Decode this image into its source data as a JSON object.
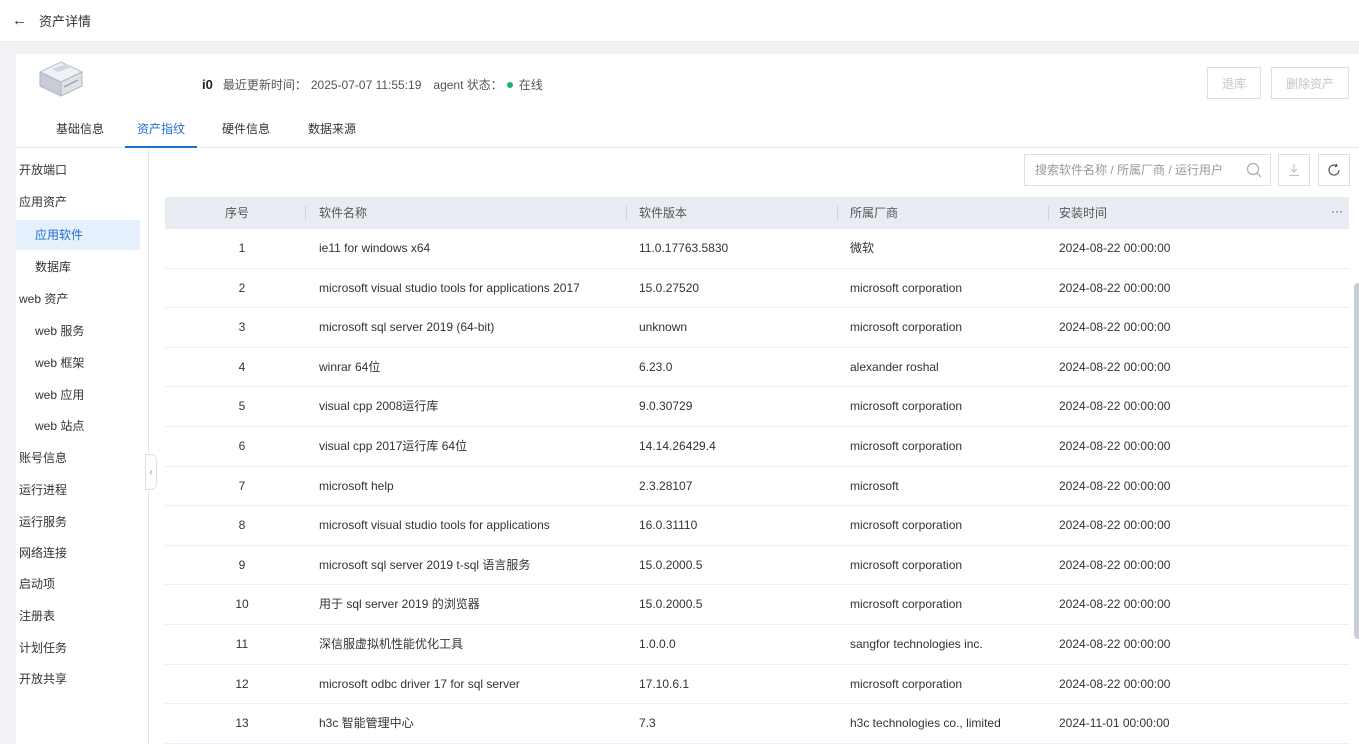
{
  "page": {
    "title": "资产详情"
  },
  "header": {
    "asset_name": "i0",
    "updated_label": "最近更新时间：",
    "updated_value": "2025-07-07 11:55:19",
    "agent_label": "agent 状态：",
    "agent_status": "在线",
    "status_color": "#19b36a"
  },
  "actions": {
    "retire": "退库",
    "delete": "删除资产"
  },
  "tabs": [
    {
      "label": "基础信息"
    },
    {
      "label": "资产指纹"
    },
    {
      "label": "硬件信息"
    },
    {
      "label": "数据来源"
    }
  ],
  "sidebar": [
    {
      "label": "开放端口"
    },
    {
      "label": "应用资产"
    },
    {
      "label": "应用软件"
    },
    {
      "label": "数据库"
    },
    {
      "label": "web 资产"
    },
    {
      "label": "web 服务"
    },
    {
      "label": "web 框架"
    },
    {
      "label": "web 应用"
    },
    {
      "label": "web 站点"
    },
    {
      "label": "账号信息"
    },
    {
      "label": "运行进程"
    },
    {
      "label": "运行服务"
    },
    {
      "label": "网络连接"
    },
    {
      "label": "启动项"
    },
    {
      "label": "注册表"
    },
    {
      "label": "计划任务"
    },
    {
      "label": "开放共享"
    }
  ],
  "search": {
    "placeholder": "搜索软件名称 / 所属厂商 / 运行用户"
  },
  "table": {
    "columns": [
      "序号",
      "软件名称",
      "软件版本",
      "所属厂商",
      "安装时间"
    ],
    "more": "···",
    "rows": [
      {
        "no": "1",
        "name": "ie11 for windows x64",
        "version": "11.0.17763.5830",
        "vendor": "微软",
        "time": "2024-08-22 00:00:00"
      },
      {
        "no": "2",
        "name": "microsoft visual studio tools for applications 2017",
        "version": "15.0.27520",
        "vendor": "microsoft corporation",
        "time": "2024-08-22 00:00:00"
      },
      {
        "no": "3",
        "name": "microsoft sql server 2019 (64-bit)",
        "version": "unknown",
        "vendor": "microsoft corporation",
        "time": "2024-08-22 00:00:00"
      },
      {
        "no": "4",
        "name": "winrar 64位",
        "version": "6.23.0",
        "vendor": "alexander roshal",
        "time": "2024-08-22 00:00:00"
      },
      {
        "no": "5",
        "name": "visual cpp 2008运行库",
        "version": "9.0.30729",
        "vendor": "microsoft corporation",
        "time": "2024-08-22 00:00:00"
      },
      {
        "no": "6",
        "name": "visual cpp 2017运行库 64位",
        "version": "14.14.26429.4",
        "vendor": "microsoft corporation",
        "time": "2024-08-22 00:00:00"
      },
      {
        "no": "7",
        "name": "microsoft help",
        "version": "2.3.28107",
        "vendor": "microsoft",
        "time": "2024-08-22 00:00:00"
      },
      {
        "no": "8",
        "name": "microsoft visual studio tools for applications",
        "version": "16.0.31110",
        "vendor": "microsoft corporation",
        "time": "2024-08-22 00:00:00"
      },
      {
        "no": "9",
        "name": "microsoft sql server 2019 t-sql 语言服务",
        "version": "15.0.2000.5",
        "vendor": "microsoft corporation",
        "time": "2024-08-22 00:00:00"
      },
      {
        "no": "10",
        "name": "用于 sql server 2019 的浏览器",
        "version": "15.0.2000.5",
        "vendor": "microsoft corporation",
        "time": "2024-08-22 00:00:00"
      },
      {
        "no": "11",
        "name": "深信服虚拟机性能优化工具",
        "version": "1.0.0.0",
        "vendor": "sangfor technologies inc.",
        "time": "2024-08-22 00:00:00"
      },
      {
        "no": "12",
        "name": "microsoft odbc driver 17 for sql server",
        "version": "17.10.6.1",
        "vendor": "microsoft corporation",
        "time": "2024-08-22 00:00:00"
      },
      {
        "no": "13",
        "name": "h3c 智能管理中心",
        "version": "7.3",
        "vendor": "h3c technologies co., limited",
        "time": "2024-11-01 00:00:00"
      }
    ]
  },
  "colors": {
    "accent": "#1f6fd1",
    "online": "#19b36a",
    "header_bg": "#e8ecf3"
  }
}
